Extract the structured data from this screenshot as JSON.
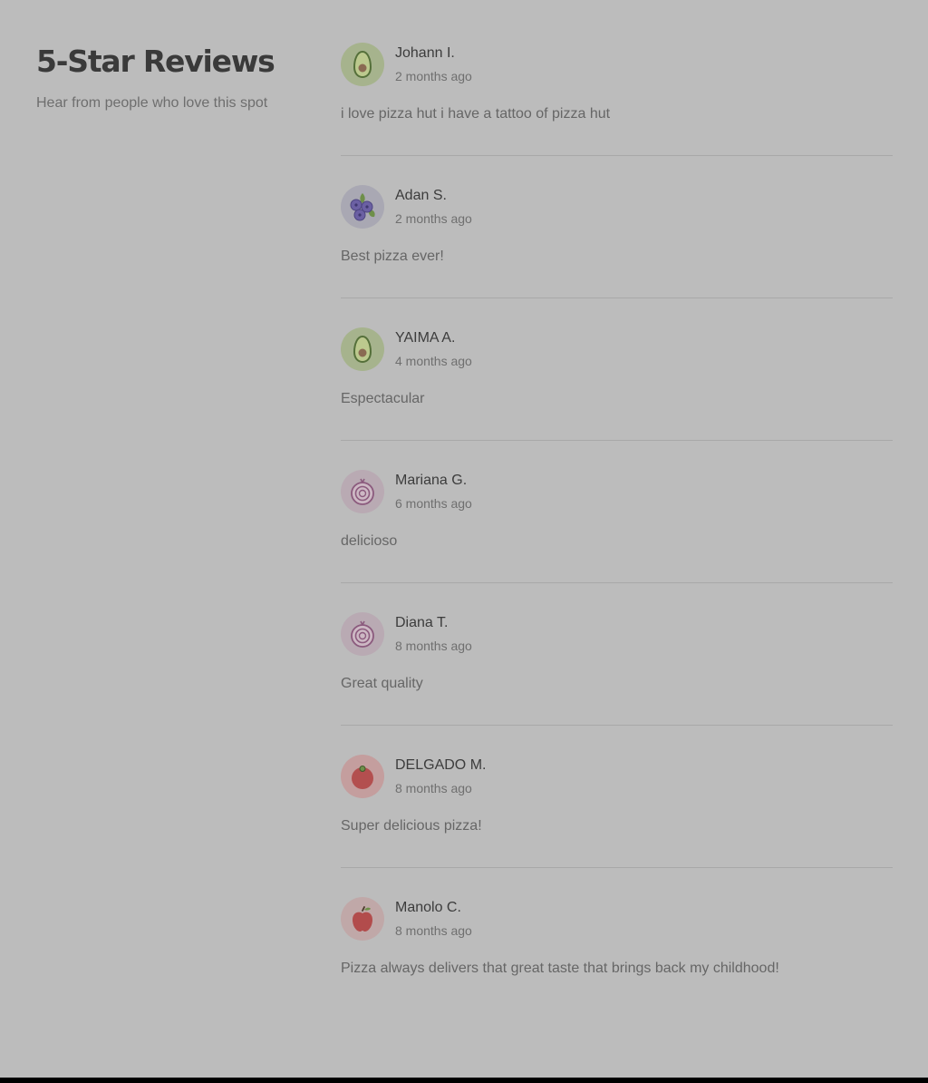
{
  "header": {
    "title": "5-Star Reviews",
    "subtitle": "Hear from people who love this spot"
  },
  "colors": {
    "background": "#bcbcbc",
    "avatar_avocado_bg": "#a6b38d",
    "avatar_blueberry_bg": "#a9a8b3",
    "avatar_onion_bg": "#b9aab3",
    "avatar_tomato_bg": "#c49e9e",
    "avatar_apple_bg": "#c0a8a8"
  },
  "reviews": [
    {
      "name": "Johann I.",
      "date": "2 months ago",
      "text": "i love pizza hut i have a tattoo of pizza hut",
      "avatar": "avocado-icon"
    },
    {
      "name": "Adan S.",
      "date": "2 months ago",
      "text": "Best pizza ever!",
      "avatar": "blueberry-icon"
    },
    {
      "name": "YAIMA A.",
      "date": "4 months ago",
      "text": "Espectacular",
      "avatar": "avocado-icon"
    },
    {
      "name": "Mariana G.",
      "date": "6 months ago",
      "text": "delicioso",
      "avatar": "onion-icon"
    },
    {
      "name": "Diana T.",
      "date": "8 months ago",
      "text": "Great quality",
      "avatar": "onion-icon"
    },
    {
      "name": "DELGADO M.",
      "date": "8 months ago",
      "text": "Super delicious pizza!",
      "avatar": "tomato-icon"
    },
    {
      "name": "Manolo C.",
      "date": "8 months ago",
      "text": "Pizza always delivers that great taste that brings back my childhood!",
      "avatar": "apple-icon"
    }
  ]
}
